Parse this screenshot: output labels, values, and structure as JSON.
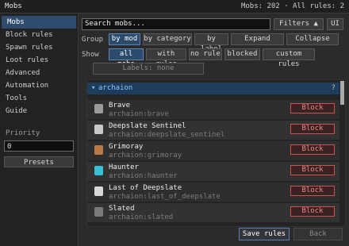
{
  "window": {
    "title": "Mobs",
    "counts": "Mobs: 202 · All rules: 2"
  },
  "sidebar": {
    "items": [
      {
        "label": "Mobs",
        "active": true
      },
      {
        "label": "Block rules"
      },
      {
        "label": "Spawn rules"
      },
      {
        "label": "Loot rules"
      },
      {
        "label": "Advanced"
      },
      {
        "label": "Automation"
      },
      {
        "label": "Tools"
      },
      {
        "label": "Guide"
      }
    ],
    "priority_label": "Priority",
    "priority_value": "0",
    "presets_label": "Presets"
  },
  "search": {
    "placeholder": "Search mobs..."
  },
  "toolbar": {
    "filters_label": "Filters ▲",
    "ui_label": "UI"
  },
  "group_row": {
    "label": "Group",
    "options": [
      "by mod",
      "by category",
      "by label"
    ],
    "selected": "by mod",
    "expand_label": "Expand",
    "collapse_label": "Collapse"
  },
  "show_row": {
    "label": "Show",
    "options": [
      "all mobs",
      "with rules",
      "no rule",
      "blocked",
      "custom rules"
    ],
    "selected": "all mobs"
  },
  "labels_button": "Labels: none",
  "list": {
    "group_name": "archaion",
    "group_help": "?",
    "mobs": [
      {
        "name": "Brave",
        "id": "archaion:brave",
        "action": "Block",
        "icon_color": "#9b9b9b"
      },
      {
        "name": "Deepslate Sentinel",
        "id": "archaion:deepslate_sentinel",
        "action": "Block",
        "icon_color": "#c9c9c9"
      },
      {
        "name": "Grimoray",
        "id": "archaion:grimoray",
        "action": "Block",
        "icon_color": "#b87a46"
      },
      {
        "name": "Haunter",
        "id": "archaion:haunter",
        "action": "Block",
        "icon_color": "#39c2d6"
      },
      {
        "name": "Last of Deepslate",
        "id": "archaion:last_of_deepslate",
        "action": "Block",
        "icon_color": "#d8d8d8"
      },
      {
        "name": "Slated",
        "id": "archaion:slated",
        "action": "Block",
        "icon_color": "#7a7a7a"
      }
    ]
  },
  "footer": {
    "save_label": "Save rules",
    "back_label": "Back"
  }
}
